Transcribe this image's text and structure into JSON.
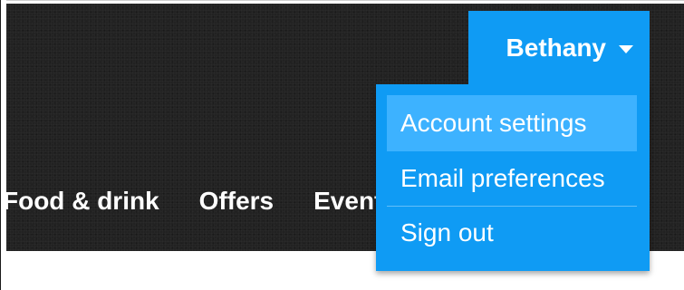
{
  "nav": {
    "items": [
      {
        "label": "Food & drink"
      },
      {
        "label": "Offers"
      },
      {
        "label": "Events"
      }
    ]
  },
  "user_menu": {
    "username": "Bethany",
    "items": [
      {
        "label": "Account settings",
        "state": "hovered"
      },
      {
        "label": "Email preferences"
      },
      {
        "label": "Sign out"
      }
    ]
  },
  "colors": {
    "header_bg": "#222222",
    "menu_bg": "#0f9bf4",
    "menu_hover_bg": "#3db2ff",
    "text": "#ffffff"
  }
}
